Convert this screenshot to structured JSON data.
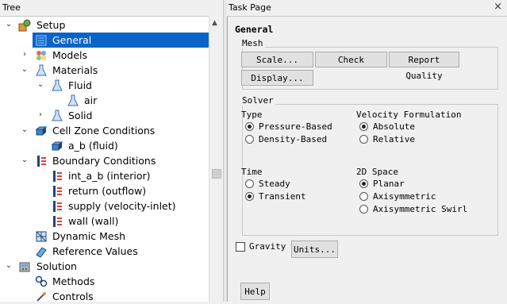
{
  "tree": {
    "title": "Tree",
    "items": [
      {
        "label": "Setup",
        "icon": "setup-icon",
        "expanded": true
      },
      {
        "label": "General",
        "icon": "general-icon",
        "selected": true
      },
      {
        "label": "Models",
        "icon": "models-icon"
      },
      {
        "label": "Materials",
        "icon": "materials-icon",
        "expanded": true
      },
      {
        "label": "Fluid",
        "icon": "flask-icon",
        "expanded": true
      },
      {
        "label": "air",
        "icon": "flask-icon"
      },
      {
        "label": "Solid",
        "icon": "flask-icon"
      },
      {
        "label": "Cell Zone Conditions",
        "icon": "cell-zone-icon",
        "expanded": true
      },
      {
        "label": "a_b (fluid)",
        "icon": "cell-zone-icon"
      },
      {
        "label": "Boundary Conditions",
        "icon": "boundary-icon",
        "expanded": true
      },
      {
        "label": "int_a_b (interior)",
        "icon": "boundary-icon"
      },
      {
        "label": "return (outflow)",
        "icon": "boundary-icon"
      },
      {
        "label": "supply (velocity-inlet)",
        "icon": "boundary-icon"
      },
      {
        "label": "wall (wall)",
        "icon": "boundary-icon"
      },
      {
        "label": "Dynamic Mesh",
        "icon": "dynamic-mesh-icon"
      },
      {
        "label": "Reference Values",
        "icon": "reference-values-icon"
      },
      {
        "label": "Solution",
        "icon": "solution-icon",
        "expanded": true
      },
      {
        "label": "Methods",
        "icon": "methods-icon"
      },
      {
        "label": "Controls",
        "icon": "controls-icon"
      }
    ]
  },
  "task": {
    "title": "Task Page",
    "close_glyph": "×",
    "heading": "General",
    "mesh": {
      "legend": "Mesh",
      "scale": "Scale...",
      "check": "Check",
      "report_quality": "Report Quality",
      "display": "Display..."
    },
    "solver": {
      "legend": "Solver",
      "type_label": "Type",
      "type_options": [
        "Pressure-Based",
        "Density-Based"
      ],
      "type_selected": 0,
      "velocity_label": "Velocity Formulation",
      "velocity_options": [
        "Absolute",
        "Relative"
      ],
      "velocity_selected": 0,
      "time_label": "Time",
      "time_options": [
        "Steady",
        "Transient"
      ],
      "time_selected": 1,
      "space_label": "2D Space",
      "space_options": [
        "Planar",
        "Axisymmetric",
        "Axisymmetric Swirl"
      ],
      "space_selected": 0
    },
    "gravity": {
      "label": "Gravity",
      "checked": false
    },
    "units_button": "Units...",
    "help_button": "Help"
  }
}
